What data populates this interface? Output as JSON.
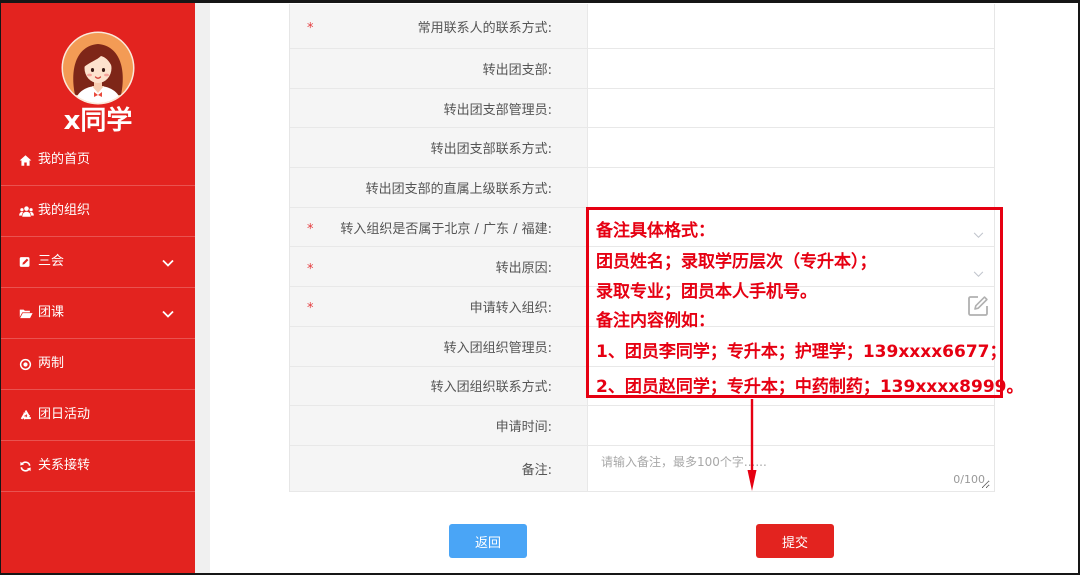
{
  "sidebar": {
    "user_name": "x同学",
    "avatar": "girl-avatar-icon",
    "items": [
      {
        "label": "我的首页",
        "icon": "home-icon"
      },
      {
        "label": "我的组织",
        "icon": "users-icon"
      },
      {
        "label": "三会",
        "icon": "edit-icon",
        "submenu_icon": "chevron-down-icon"
      },
      {
        "label": "团课",
        "icon": "folder-open-icon",
        "submenu_icon": "chevron-down-icon"
      },
      {
        "label": "两制",
        "icon": "dot-circle-icon"
      },
      {
        "label": "团日活动",
        "icon": "recycle-icon"
      },
      {
        "label": "关系接转",
        "icon": "refresh-icon"
      }
    ]
  },
  "form": {
    "required_mark": "*",
    "rows": [
      {
        "label": "常用联系人的联系方式:",
        "required": true,
        "value": ""
      },
      {
        "label": "转出团支部:",
        "required": false,
        "value": ""
      },
      {
        "label": "转出团支部管理员:",
        "required": false,
        "value": ""
      },
      {
        "label": "转出团支部联系方式:",
        "required": false,
        "value": ""
      },
      {
        "label": "转出团支部的直属上级联系方式:",
        "required": false,
        "value": ""
      },
      {
        "label": "转入组织是否属于北京 / 广东 / 福建:",
        "required": true,
        "value": "",
        "icon": "chevron-down-icon"
      },
      {
        "label": "转出原因:",
        "required": true,
        "value": "",
        "icon": "chevron-down-icon"
      },
      {
        "label": "申请转入组织:",
        "required": true,
        "value": "",
        "icon": "edit-icon"
      },
      {
        "label": "转入团组织管理员:",
        "required": false,
        "value": ""
      },
      {
        "label": "转入团组织联系方式:",
        "required": false,
        "value": ""
      },
      {
        "label": "申请时间:",
        "required": false,
        "value": ""
      }
    ],
    "remark": {
      "label": "备注:",
      "placeholder": "请输入备注，最多100个字......",
      "counter": "0/100"
    }
  },
  "buttons": {
    "back": "返回",
    "submit": "提交"
  },
  "annotation": {
    "lines": [
      "备注具体格式：",
      "团员姓名；录取学历层次（专升本）；",
      "录取专业；团员本人手机号。",
      "备注内容例如：",
      "1、团员李同学；专升本；护理学；139xxxx6677；",
      "2、团员赵同学；专升本；中药制药；139xxxx8999。"
    ],
    "arrow_icon": "arrow-down-icon"
  },
  "colors": {
    "sidebar_bg": "#e3231f",
    "annotation": "#e60012",
    "required_mark": "#e4393c",
    "back_button": "#4aa5f6",
    "submit_button": "#e3231f"
  }
}
